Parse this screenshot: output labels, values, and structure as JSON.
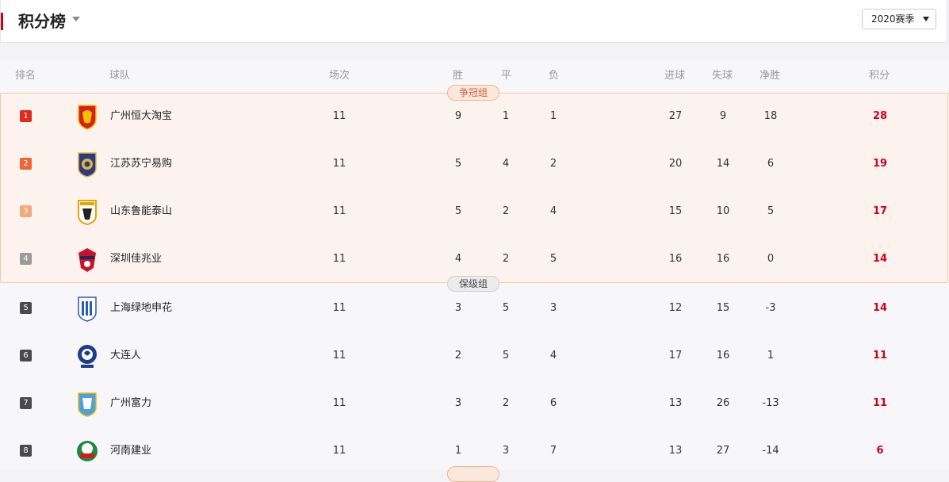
{
  "header": {
    "title": "积分榜",
    "season": "2020赛季"
  },
  "columns": {
    "rank": "排名",
    "team": "球队",
    "played": "场次",
    "won": "胜",
    "drawn": "平",
    "lost": "负",
    "gf": "进球",
    "ga": "失球",
    "gd": "净胜",
    "points": "积分"
  },
  "groups": {
    "championship": "争冠组",
    "relegation": "保级组"
  },
  "colors": {
    "accent": "#d0021b",
    "rank1": "#e0281e",
    "rank2": "#f0643a",
    "rank3": "#f5a77c",
    "rank4": "#9b9b9b",
    "rankOther": "#4a4a4a"
  },
  "rows": [
    {
      "rank": "1",
      "team": "广州恒大淘宝",
      "played": "11",
      "won": "9",
      "drawn": "1",
      "lost": "1",
      "gf": "27",
      "ga": "9",
      "gd": "18",
      "points": "28",
      "logo": "guangzhou-evergrande-logo"
    },
    {
      "rank": "2",
      "team": "江苏苏宁易购",
      "played": "11",
      "won": "5",
      "drawn": "4",
      "lost": "2",
      "gf": "20",
      "ga": "14",
      "gd": "6",
      "points": "19",
      "logo": "jiangsu-suning-logo"
    },
    {
      "rank": "3",
      "team": "山东鲁能泰山",
      "played": "11",
      "won": "5",
      "drawn": "2",
      "lost": "4",
      "gf": "15",
      "ga": "10",
      "gd": "5",
      "points": "17",
      "logo": "shandong-luneng-logo"
    },
    {
      "rank": "4",
      "team": "深圳佳兆业",
      "played": "11",
      "won": "4",
      "drawn": "2",
      "lost": "5",
      "gf": "16",
      "ga": "16",
      "gd": "0",
      "points": "14",
      "logo": "shenzhen-kaisa-logo"
    },
    {
      "rank": "5",
      "team": "上海绿地申花",
      "played": "11",
      "won": "3",
      "drawn": "5",
      "lost": "3",
      "gf": "12",
      "ga": "15",
      "gd": "-3",
      "points": "14",
      "logo": "shanghai-shenhua-logo"
    },
    {
      "rank": "6",
      "team": "大连人",
      "played": "11",
      "won": "2",
      "drawn": "5",
      "lost": "4",
      "gf": "17",
      "ga": "16",
      "gd": "1",
      "points": "11",
      "logo": "dalian-pro-logo"
    },
    {
      "rank": "7",
      "team": "广州富力",
      "played": "11",
      "won": "3",
      "drawn": "2",
      "lost": "6",
      "gf": "13",
      "ga": "26",
      "gd": "-13",
      "points": "11",
      "logo": "guangzhou-rf-logo"
    },
    {
      "rank": "8",
      "team": "河南建业",
      "played": "11",
      "won": "1",
      "drawn": "3",
      "lost": "7",
      "gf": "13",
      "ga": "27",
      "gd": "-14",
      "points": "6",
      "logo": "henan-jianye-logo"
    }
  ]
}
